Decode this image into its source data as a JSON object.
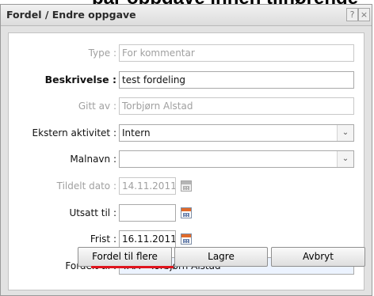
{
  "backdrop_text": "par oppgave innen tilhørende",
  "dialog": {
    "title": "Fordel / Endre oppgave",
    "help_icon": "?",
    "close_icon": "×"
  },
  "form": {
    "type": {
      "label": "Type :",
      "value": "For kommentar"
    },
    "beskrivelse": {
      "label": "Beskrivelse :",
      "value": "test fordeling"
    },
    "gitt_av": {
      "label": "Gitt av :",
      "value": "Torbjørn Alstad"
    },
    "ekstern_aktivitet": {
      "label": "Ekstern aktivitet :",
      "value": "Intern"
    },
    "malnavn": {
      "label": "Malnavn :",
      "value": ""
    },
    "tildelt_dato": {
      "label": "Tildelt dato :",
      "value": "14.11.2011"
    },
    "utsatt_til": {
      "label": "Utsatt til :",
      "value": ""
    },
    "frist": {
      "label": "Frist :",
      "value": "16.11.2011"
    },
    "fordelt_til": {
      "label": "Fordelt til :",
      "value": "TAA - Torbjørn Alstad"
    }
  },
  "buttons": {
    "fordel_til_flere": "Fordel til flere",
    "lagre": "Lagre",
    "avbryt": "Avbryt"
  },
  "icons": {
    "dropdown": "chevron-down-icon",
    "calendar": "calendar-icon"
  },
  "colors": {
    "underline_accent": "#e0141c",
    "dialog_bg": "#e2e2e2",
    "fordelt_til_bg": "#ecf3ff"
  }
}
